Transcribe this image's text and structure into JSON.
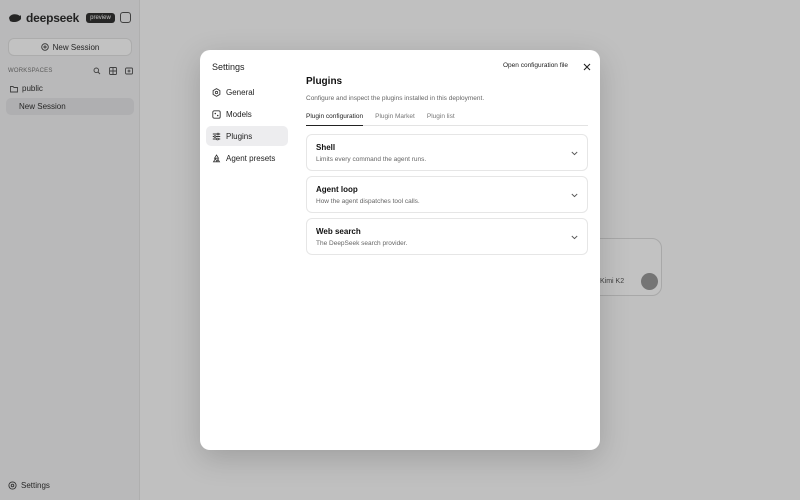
{
  "sidebar": {
    "brand": "deepseek",
    "badge": "preview",
    "new_session": "New Session",
    "workspace_label": "WORKSPACES",
    "folder": "public",
    "session_item": "New Session",
    "settings": "Settings"
  },
  "composer": {
    "model": "Kimi K2"
  },
  "modal": {
    "title": "Settings",
    "nav": [
      {
        "label": "General",
        "icon": "hexagon-icon"
      },
      {
        "label": "Models",
        "icon": "model-icon"
      },
      {
        "label": "Plugins",
        "icon": "sliders-icon"
      },
      {
        "label": "Agent presets",
        "icon": "recycle-icon"
      }
    ],
    "active_nav": "Plugins",
    "content_title": "Plugins",
    "content_desc": "Configure and inspect the plugins installed in this deployment.",
    "open_config": "Open configuration file",
    "tabs": [
      "Plugin configuration",
      "Plugin Market",
      "Plugin list"
    ],
    "active_tab": "Plugin configuration",
    "cards": [
      {
        "title": "Shell",
        "subtitle": "Limits every command the agent runs."
      },
      {
        "title": "Agent loop",
        "subtitle": "How the agent dispatches tool calls."
      },
      {
        "title": "Web search",
        "subtitle": "The DeepSeek search provider."
      }
    ]
  }
}
